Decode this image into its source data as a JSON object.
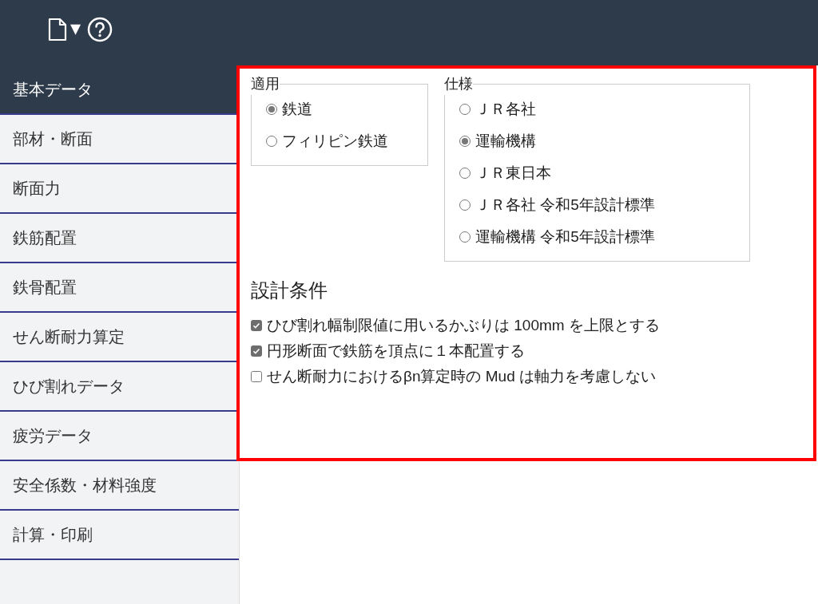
{
  "toolbar": {
    "menu_caret": "▾"
  },
  "sidebar": {
    "items": [
      {
        "label": "基本データ",
        "selected": true
      },
      {
        "label": "部材・断面",
        "selected": false
      },
      {
        "label": "断面力",
        "selected": false
      },
      {
        "label": "鉄筋配置",
        "selected": false
      },
      {
        "label": "鉄骨配置",
        "selected": false
      },
      {
        "label": "せん断耐力算定",
        "selected": false
      },
      {
        "label": "ひび割れデータ",
        "selected": false
      },
      {
        "label": "疲労データ",
        "selected": false
      },
      {
        "label": "安全係数・材料強度",
        "selected": false
      },
      {
        "label": "計算・印刷",
        "selected": false
      }
    ]
  },
  "application": {
    "legend": "適用",
    "options": [
      {
        "label": "鉄道",
        "selected": true
      },
      {
        "label": "フィリピン鉄道",
        "selected": false
      }
    ]
  },
  "specification": {
    "legend": "仕様",
    "options": [
      {
        "label": "ＪＲ各社",
        "selected": false
      },
      {
        "label": "運輸機構",
        "selected": true
      },
      {
        "label": "ＪＲ東日本",
        "selected": false
      },
      {
        "label": "ＪＲ各社 令和5年設計標準",
        "selected": false
      },
      {
        "label": "運輸機構 令和5年設計標準",
        "selected": false
      }
    ]
  },
  "design_conditions": {
    "title": "設計条件",
    "options": [
      {
        "label": "ひび割れ幅制限値に用いるかぶりは 100mm を上限とする",
        "checked": true
      },
      {
        "label": "円形断面で鉄筋を頂点に１本配置する",
        "checked": true
      },
      {
        "label": "せん断耐力におけるβn算定時の Mud は軸力を考慮しない",
        "checked": false
      }
    ]
  }
}
